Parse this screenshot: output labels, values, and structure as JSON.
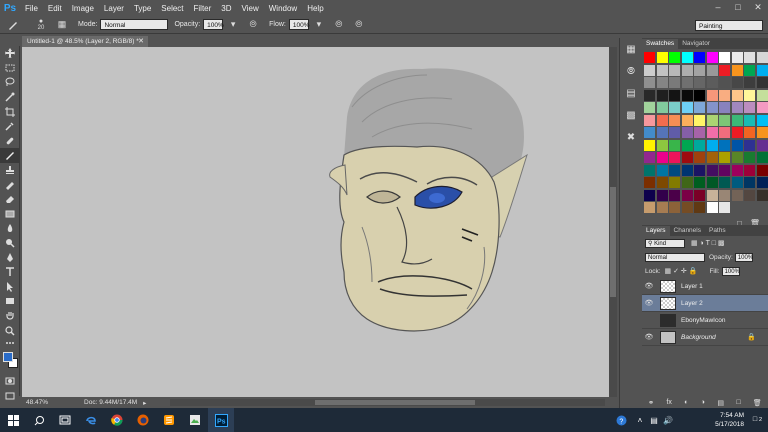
{
  "app": {
    "logo": "Ps"
  },
  "menu": [
    "File",
    "Edit",
    "Image",
    "Layer",
    "Type",
    "Select",
    "Filter",
    "3D",
    "View",
    "Window",
    "Help"
  ],
  "options": {
    "brush_size": "20",
    "mode_label": "Mode:",
    "mode_value": "Normal",
    "opacity_label": "Opacity:",
    "opacity_value": "100%",
    "flow_label": "Flow:",
    "flow_value": "100%",
    "workspace": "Painting"
  },
  "document": {
    "tab_title": "Untitled-1 @ 48.5% (Layer 2, RGB/8) *",
    "zoom": "48.47%",
    "doc_info": "Doc: 9.44M/17.4M"
  },
  "swatches_panel": {
    "tabs": [
      "Swatches",
      "Navigator"
    ],
    "colors": [
      "#ff0000",
      "#ffff00",
      "#00ff00",
      "#00ffff",
      "#0000ff",
      "#ff00ff",
      "#ffffff",
      "#ebebeb",
      "#e0e0e0",
      "#d6d6d6",
      "#cccccc",
      "#c2c2c2",
      "#b8b8b8",
      "#adadad",
      "#a3a3a3",
      "#999999",
      "#ed1c24",
      "#f7941d",
      "#00a651",
      "#00aeef",
      "#8f8f8f",
      "#858585",
      "#7a7a7a",
      "#707070",
      "#666666",
      "#5c5c5c",
      "#525252",
      "#474747",
      "#3d3d3d",
      "#333333",
      "#292929",
      "#1f1f1f",
      "#141414",
      "#0a0a0a",
      "#000000",
      "#f7977a",
      "#f9ad81",
      "#fdc68a",
      "#fff79a",
      "#c4df9b",
      "#a2d39c",
      "#82ca9d",
      "#7bcdc8",
      "#6ecff6",
      "#7ea7d8",
      "#8493ca",
      "#8882be",
      "#a187be",
      "#bc8dbf",
      "#f49ac2",
      "#f6989d",
      "#f26c4f",
      "#f68e55",
      "#fbaf5c",
      "#fff467",
      "#acd372",
      "#7cc576",
      "#3bb878",
      "#1abbb4",
      "#00bff3",
      "#438ccb",
      "#5574b9",
      "#605ca8",
      "#855fa8",
      "#a763a8",
      "#f06ea9",
      "#f26d7d",
      "#ed1c24",
      "#f26522",
      "#f7941d",
      "#fff200",
      "#8dc73f",
      "#39b54a",
      "#00a651",
      "#00a99d",
      "#00aeef",
      "#0072bc",
      "#0054a6",
      "#2e3192",
      "#662d91",
      "#92278f",
      "#ec008c",
      "#ed145b",
      "#9e0b0f",
      "#a0410d",
      "#a36209",
      "#aba000",
      "#598527",
      "#197b30",
      "#007236",
      "#00746b",
      "#0076a3",
      "#004a80",
      "#003471",
      "#1b1464",
      "#440e62",
      "#630460",
      "#9e005d",
      "#9e0039",
      "#790000",
      "#7b2e00",
      "#7d4900",
      "#827b00",
      "#406618",
      "#005e20",
      "#005826",
      "#005952",
      "#005b7f",
      "#003663",
      "#002157",
      "#0d004c",
      "#32004b",
      "#4b0049",
      "#7b0046",
      "#7a0026",
      "#c7b299",
      "#998675",
      "#736357",
      "#534741",
      "#37302a",
      "#c69c6d",
      "#a67c52",
      "#8c6239",
      "#754c24",
      "#603913",
      "#ffffff",
      "#e6e6e6"
    ]
  },
  "layers_panel": {
    "tabs": [
      "Layers",
      "Channels",
      "Paths"
    ],
    "kind_label": "Kind",
    "blend_mode": "Normal",
    "opacity_label": "Opacity:",
    "opacity_value": "100%",
    "lock_label": "Lock:",
    "fill_label": "Fill:",
    "fill_value": "100%",
    "layers": [
      {
        "name": "Layer 1",
        "visible": true,
        "selected": false
      },
      {
        "name": "Layer 2",
        "visible": true,
        "selected": true
      },
      {
        "name": "EbonyMawIcon",
        "visible": false,
        "selected": false
      },
      {
        "name": "Background",
        "visible": true,
        "selected": false,
        "locked": true
      }
    ]
  },
  "taskbar": {
    "time": "7:54 AM",
    "date": "5/17/2018",
    "notification_count": "2"
  }
}
